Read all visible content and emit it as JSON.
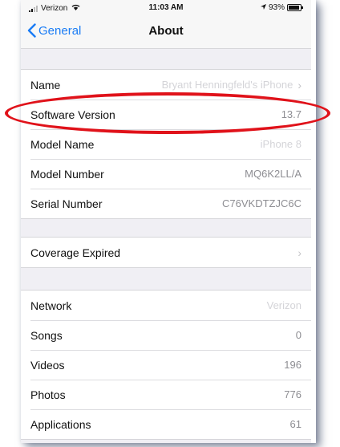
{
  "status_bar": {
    "carrier": "Verizon",
    "time": "11:03 AM",
    "battery": "93%",
    "battery_level": 0.93
  },
  "nav": {
    "back_label": "General",
    "title": "About"
  },
  "group1": [
    {
      "label": "Name",
      "value": "Bryant Henningfeld's iPhone",
      "chevron": true
    },
    {
      "label": "Software Version",
      "value": "13.7",
      "chevron": false
    },
    {
      "label": "Model Name",
      "value": "iPhone 8",
      "chevron": false
    },
    {
      "label": "Model Number",
      "value": "MQ6K2LL/A",
      "chevron": false
    },
    {
      "label": "Serial Number",
      "value": "C76VKDTZJC6C",
      "chevron": false
    }
  ],
  "group2": [
    {
      "label": "Coverage Expired",
      "chevron": true
    }
  ],
  "group3": [
    {
      "label": "Network",
      "value": "Verizon"
    },
    {
      "label": "Songs",
      "value": "0"
    },
    {
      "label": "Videos",
      "value": "196"
    },
    {
      "label": "Photos",
      "value": "776"
    },
    {
      "label": "Applications",
      "value": "61"
    }
  ],
  "colors": {
    "accent": "#1a7cf5",
    "annotation": "#e0121a",
    "background": "#f0eff4"
  },
  "icons": {
    "back": "chevron-left-icon",
    "disclosure": "chevron-right-icon",
    "wifi": "wifi-icon",
    "battery": "battery-icon",
    "signal": "signal-icon",
    "location": "location-arrow-icon"
  }
}
